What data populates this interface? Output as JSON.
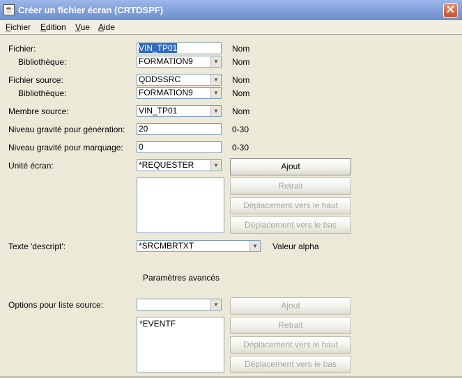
{
  "window": {
    "title": "Créer un fichier écran (CRTDSPF)",
    "app_icon": "java-coffee-cup-icon",
    "close_icon": "close-x-icon",
    "close_glyph": "✕"
  },
  "menu": [
    {
      "label": "Fichier",
      "mnemonic": "F",
      "rest": "ichier"
    },
    {
      "label": "Edition",
      "mnemonic": "E",
      "rest": "dition"
    },
    {
      "label": "Vue",
      "mnemonic": "V",
      "rest": "ue"
    },
    {
      "label": "Aide",
      "mnemonic": "A",
      "rest": "ide"
    }
  ],
  "form": {
    "fichier": {
      "label": "Fichier:",
      "value": "VIN_TP01",
      "hint": "Nom"
    },
    "fichier_lib": {
      "label": "Bibliothèque:",
      "value": "FORMATION9",
      "hint": "Nom"
    },
    "fichier_source": {
      "label": "Fichier source:",
      "value": "QDDSSRC",
      "hint": "Nom"
    },
    "source_lib": {
      "label": "Bibliothèque:",
      "value": "FORMATION9",
      "hint": "Nom"
    },
    "membre_source": {
      "label": "Membre source:",
      "value": "VIN_TP01",
      "hint": "Nom"
    },
    "gravite_generation": {
      "label": "Niveau gravité pour génération:",
      "value": "20",
      "hint": "0-30"
    },
    "gravite_marquage": {
      "label": "Niveau gravité pour marquage:",
      "value": "0",
      "hint": "0-30"
    },
    "unite_ecran": {
      "label": "Unité écran:",
      "value": "*REQUESTER",
      "items": [],
      "buttons": {
        "add": "Ajout",
        "remove": "Retrait",
        "move_up": "Déplacement vers le haut",
        "move_down": "Déplacement vers le bas"
      }
    },
    "texte": {
      "label": "Texte 'descript':",
      "value": "*SRCMBRTXT",
      "hint": "Valeur alpha"
    },
    "advanced_label": "Paramètres avancés",
    "options_liste": {
      "label": "Options pour liste source:",
      "value": "",
      "items": [
        "*EVENTF"
      ],
      "buttons": {
        "add": "Ajout",
        "remove": "Retrait",
        "move_up": "Déplacement vers le haut",
        "move_down": "Déplacement vers le bas"
      }
    }
  },
  "icons": {
    "dropdown": "chevron-down-icon",
    "dropdown_glyph": "▼"
  },
  "colors": {
    "titlebar": "#7F9FD9",
    "selection": "#316AC5",
    "window_bg": "#ECE9D8"
  }
}
